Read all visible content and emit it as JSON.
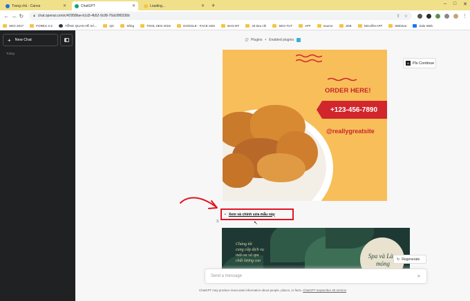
{
  "browser": {
    "tabs": [
      {
        "title": "Trang chủ - Canva",
        "active": false,
        "favicon_color": "#1a73e8"
      },
      {
        "title": "ChatGPT",
        "active": true,
        "favicon_color": "#10a37f"
      },
      {
        "title": "Loading...",
        "active": false,
        "favicon_color": "#f4c542"
      }
    ],
    "new_tab": "+",
    "url": "chat.openai.com/c/42958fae-b1d3-4b52-9c98-76dcf9f0336b",
    "bookmarks": [
      "SEO 2017",
      "FOREX 4-2",
      "TỔNG QUAN VỀ SẢ...",
      "QC",
      "Sống",
      "TOOL SEO 2019",
      "GOOGLE - FACE ADS",
      "BAO ĐT",
      "33 tieu chi",
      "SEO TUT",
      "AFF",
      "source",
      "JOB",
      "NGUỒN AFF",
      "Webinar",
      "Zalo Web"
    ]
  },
  "sidebar": {
    "new_chat_label": "New Chat",
    "section_today": "Today"
  },
  "main": {
    "plugins_label": "Plugins",
    "enabled_plugins_label": "Enabled plugins:",
    "poster1": {
      "order_text": "ORDER HERE!",
      "phone": "+123-456-7890",
      "handle": "@reallygreatsite"
    },
    "continue_label": "Pls Continue",
    "list_number": "3.",
    "edit_link": "Xem và chỉnh sửa mẫu này",
    "poster2": {
      "text": [
        "Chúng tôi",
        "cung cấp dịch vụ",
        "mát-xa và spa",
        "chất lượng cao"
      ],
      "circle_text": "Spa và Làm móng"
    },
    "regenerate_label": "Regenerate",
    "composer_placeholder": "Send a message",
    "disclaimer": "ChatGPT may produce inaccurate information about people, places, or facts.",
    "disclaimer_link": "ChatGPT September 25 Version"
  },
  "colors": {
    "sidebar_bg": "#202123",
    "poster1_bg": "#f8be5a",
    "poster1_red": "#d0262c",
    "annotation_red": "#e0141e",
    "poster2_bg": "#1e3934"
  }
}
